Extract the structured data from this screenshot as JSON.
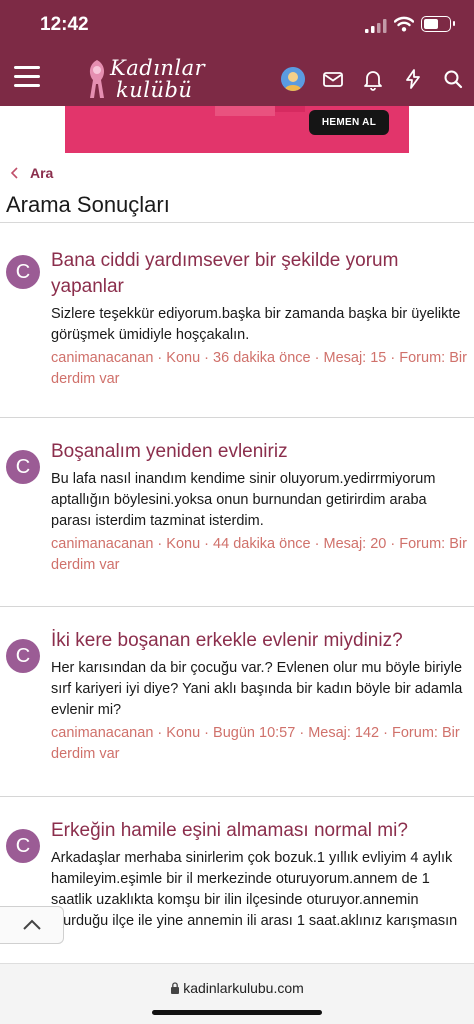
{
  "status_bar": {
    "time": "12:42",
    "battery_level": 0.6
  },
  "header": {
    "logo_line1": "Kadınlar",
    "logo_line2": "kulübü",
    "icons": [
      "hamburger-menu-icon",
      "user-avatar",
      "mail-icon",
      "bell-icon",
      "lightning-icon",
      "search-icon"
    ],
    "brand_color": "#7d2a45"
  },
  "ad": {
    "button_label": "HEMEN AL",
    "background_color": "#e2356b"
  },
  "breadcrumb": {
    "label": "Ara"
  },
  "page": {
    "title": "Arama Sonuçları"
  },
  "results": [
    {
      "avatar_letter": "C",
      "title": "Bana ciddi yardımsever bir şekilde yorum yapanlar",
      "snippet": "Sizlere teşekkür ediyorum.başka bir zamanda başka bir üyelikte görüşmek ümidiyle hoşçakalın.",
      "author": "canimanacanan",
      "type": "Konu",
      "time": "36 dakika önce",
      "replies": "Mesaj: 15",
      "forum": "Forum: Bir derdim var"
    },
    {
      "avatar_letter": "C",
      "title": "Boşanalım yeniden evleniriz",
      "snippet": "Bu lafa nasıl inandım kendime sinir oluyorum.yedirrmiyorum aptallığın böylesini.yoksa onun burnundan getirirdim araba parası isterdim tazminat isterdim.",
      "author": "canimanacanan",
      "type": "Konu",
      "time": "44 dakika önce",
      "replies": "Mesaj: 20",
      "forum": "Forum: Bir derdim var"
    },
    {
      "avatar_letter": "C",
      "title": "İki kere boşanan erkekle evlenir miydiniz?",
      "snippet": "Her karısından da bir çocuğu var.? Evlenen olur mu böyle biriyle sırf kariyeri iyi diye? Yani aklı başında bir kadın böyle bir adamla evlenir mi?",
      "author": "canimanacanan",
      "type": "Konu",
      "time": "Bugün 10:57",
      "replies": "Mesaj: 142",
      "forum": "Forum: Bir derdim var"
    },
    {
      "avatar_letter": "C",
      "title": "Erkeğin hamile eşini almaması normal mi?",
      "snippet": "Arkadaşlar merhaba sinirlerim çok bozuk.1 yıllık evliyim 4 aylık hamileyim.eşimle bir il merkezinde oturuyorum.annem de 1 saatlik uzaklıkta komşu bir ilin ilçesinde oturuyor.annemin oturduğu ilçe ile yine annemin ili arası 1 saat.aklınız karışmasın",
      "author": "",
      "type": "",
      "time": "",
      "replies": "",
      "forum": ""
    }
  ],
  "browser": {
    "url": "kadinlarkulubu.com"
  }
}
